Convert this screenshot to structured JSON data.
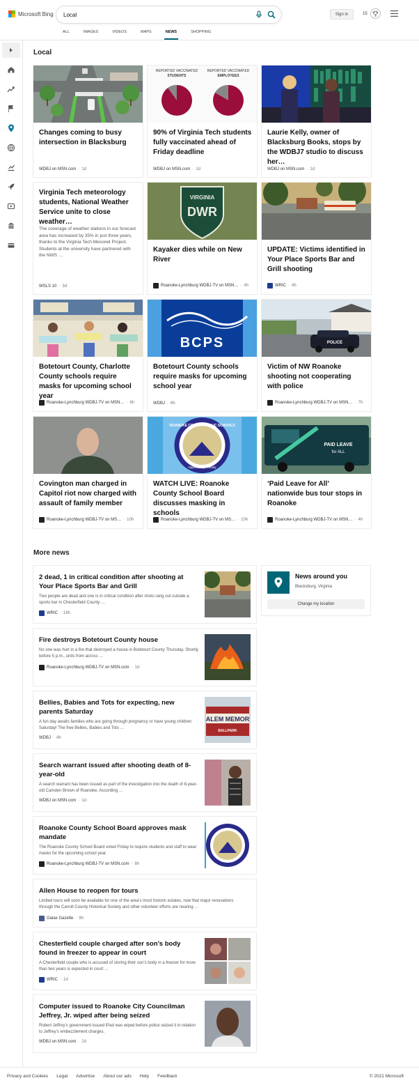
{
  "brand": {
    "logo_text": "Microsoft Bing"
  },
  "search": {
    "query": "Local"
  },
  "header": {
    "signin_label": "Sign in",
    "rewards_count": "15"
  },
  "tabs": [
    {
      "label": "ALL"
    },
    {
      "label": "IMAGES"
    },
    {
      "label": "VIDEOS"
    },
    {
      "label": "MAPS"
    },
    {
      "label": "NEWS"
    },
    {
      "label": "SHOPPING"
    }
  ],
  "active_tab": "NEWS",
  "colors": {
    "accent": "#006677",
    "bing_teal": "#067"
  },
  "sidebar": {
    "icons": [
      "home-icon",
      "trending-icon",
      "flag-icon",
      "location-icon",
      "globe-icon",
      "chart-icon",
      "rocket-icon",
      "video-icon",
      "building-icon",
      "card-icon"
    ]
  },
  "local": {
    "title": "Local",
    "cards": [
      {
        "title": "Changes coming to busy intersection in Blacksburg",
        "source": "WDBJ on MSN.com",
        "time": "1d",
        "image": "street-intersection"
      },
      {
        "title": "90% of Virginia Tech students fully vaccinated ahead of Friday deadline",
        "source": "WDBJ on MSN.com",
        "time": "1d",
        "image": "pie-charts",
        "img_labels": [
          "REPORTED VACCINATED",
          "STUDENTS",
          "REPORTED VACCINATED",
          "EMPLOYEES"
        ]
      },
      {
        "title": "Laurie Kelly, owner of Blacksburg Books, stops by the WDBJ7 studio to discuss her…",
        "source": "WDBJ on MSN.com",
        "time": "1d",
        "image": "studio"
      },
      {
        "title": "Virginia Tech meteorology students, National Weather Service unite to close weather…",
        "desc": "The coverage of weather stations in our forecast area has increased by 35% in just three years, thanks to the Virginia Tech Mesonet Project. Students at the university have partnered with the NWS …",
        "source": "WSLS 10",
        "time": "3d",
        "image": "none"
      },
      {
        "title": "Kayaker dies while on New River",
        "source": "Roanoke-Lynchburg WDBJ-TV on MSN…",
        "time": "4h",
        "image": "dwr",
        "img_labels": [
          "VIRGINIA",
          "DWR"
        ]
      },
      {
        "title": "UPDATE: Victims identified in Your Place Sports Bar and Grill shooting",
        "source": "WRIC",
        "time": "4h",
        "image": "parking-lot"
      },
      {
        "title": "Botetourt County, Charlotte County schools require masks for upcoming school year",
        "source": "Roanoke-Lynchburg WDBJ-TV on MSN…",
        "time": "6h",
        "image": "classroom"
      },
      {
        "title": "Botetourt County schools require masks for upcoming school year",
        "source": "WDBJ",
        "time": "6h",
        "image": "bcps",
        "img_labels": [
          "BCPS"
        ]
      },
      {
        "title": "Victim of NW Roanoke shooting not cooperating with police",
        "source": "Roanoke-Lynchburg WDBJ-TV on MSN…",
        "time": "7h",
        "image": "police",
        "img_labels": [
          "POLICE"
        ]
      },
      {
        "title": "Covington man charged in Capitol riot now charged with assault of family member",
        "source": "Roanoke-Lynchburg WDBJ-TV on MS…",
        "time": "10h",
        "image": "mugshot"
      },
      {
        "title": "WATCH LIVE: Roanoke County School Board discusses masking in schools",
        "source": "Roanoke-Lynchburg WDBJ-TV on MS…",
        "time": "10h",
        "image": "rcps",
        "img_labels": [
          "ROANOKE COUNTY PUBLIC SCHOOLS",
          "Opportunity • Ready"
        ]
      },
      {
        "title": "‘Paid Leave for All’ nationwide bus tour stops in Roanoke",
        "source": "Roanoke-Lynchburg WDBJ-TV on MSN…",
        "time": "4h",
        "image": "bus",
        "img_labels": [
          "PAID LEAVE",
          "for ALL"
        ]
      }
    ]
  },
  "more_news": {
    "title": "More news",
    "items": [
      {
        "title": "2 dead, 1 in critical condition after shooting at Your Place Sports Bar and Grill",
        "desc": "Two people are dead and one is in critical condition after shots rang out outside a sports bar in Chesterfield County …",
        "source": "WRIC",
        "time": "18h",
        "image": "parking-lot"
      },
      {
        "title": "Fire destroys Botetourt County house",
        "desc": "No one was hurt in a fire that destroyed a house in Botetourt County Thursday. Shortly before 5 p.m., units from across …",
        "source": "Roanoke-Lynchburg WDBJ-TV on MSN.com",
        "time": "1d",
        "image": "fire"
      },
      {
        "title": "Bellies, Babies and Tots for expecting, new parents Saturday",
        "desc": "A fun day awaits families who are going through pregnancy or have young children Saturday! The free Bellies, Babies and Tots …",
        "source": "WDBJ",
        "time": "4h",
        "image": "memorial",
        "img_labels": [
          "ALEM MEMOR",
          "BALLPARK"
        ]
      },
      {
        "title": "Search warrant issued after shooting death of 8-year-old",
        "desc": "A search warrant has been issued as part of the investigation into the death of 8-year-old Camden Brown of Roanoke. According …",
        "source": "WDBJ on MSN.com",
        "time": "1d",
        "image": "boy"
      },
      {
        "title": "Roanoke County School Board approves mask mandate",
        "desc": "The Roanoke County School Board voted Friday to require students and staff to wear masks for the upcoming school year.",
        "source": "Roanoke-Lynchburg WDBJ-TV on MSN.com",
        "time": "8h",
        "image": "rcps-small"
      },
      {
        "title": "Allen House to reopen for tours",
        "desc": "Limited tours will soon be available for one of the area’s most historic estates, now that major renovations through the Carroll County Historical Society and other volunteer efforts are nearing …",
        "source": "Galax Gazette",
        "time": "9h",
        "image": "none"
      },
      {
        "title": "Chesterfield couple charged after son’s body found in freezer to appear in court",
        "desc": "A Chesterfield couple who is accused of storing their son’s body in a freezer for more than two years is expected in court …",
        "source": "WRIC",
        "time": "1d",
        "image": "collage"
      },
      {
        "title": "Computer issued to Roanoke City Councilman Jeffrey, Jr. wiped after being seized",
        "desc": "Robert Jeffrey’s government issued iPad was wiped before police seized it in relation to Jeffrey’s embezzlement charges.",
        "source": "WDBJ on MSN.com",
        "time": "2d",
        "image": "portrait"
      }
    ]
  },
  "news_around": {
    "title": "News around you",
    "location": "Blacksburg, Virginia",
    "button": "Change my location"
  },
  "footer": {
    "links": [
      "Privacy and Cookies",
      "Legal",
      "Advertise",
      "About our ads",
      "Help",
      "Feedback"
    ],
    "copyright": "© 2021 Microsoft"
  }
}
